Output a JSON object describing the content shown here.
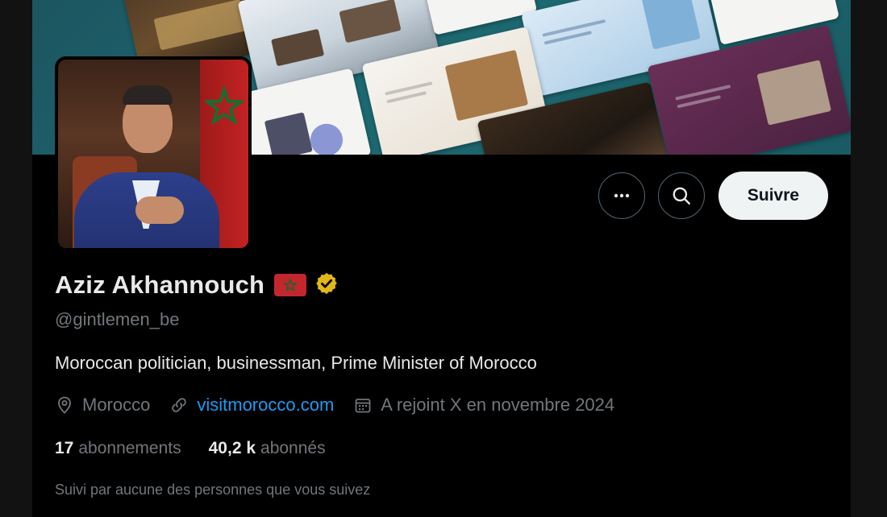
{
  "profile": {
    "display_name": "Aziz Akhannouch",
    "handle": "@gintlemen_be",
    "bio": "Moroccan politician, businessman, Prime Minister of Morocco",
    "location": "Morocco",
    "website": "visitmorocco.com",
    "joined": "A rejoint X en novembre 2024"
  },
  "stats": {
    "following_count": "17",
    "following_label": "abonnements",
    "followers_count": "40,2 k",
    "followers_label": "abonnés"
  },
  "followed_by": "Suivi par aucune des personnes que vous suivez",
  "actions": {
    "follow_label": "Suivre",
    "more_icon": "ellipsis-icon",
    "search_icon": "search-icon"
  },
  "colors": {
    "background": "#000000",
    "primary_text": "#e7e9ea",
    "secondary_text": "#71767b",
    "link": "#1d9bf0",
    "verified_badge": "#e2b719",
    "follow_button_bg": "#eff3f4"
  }
}
